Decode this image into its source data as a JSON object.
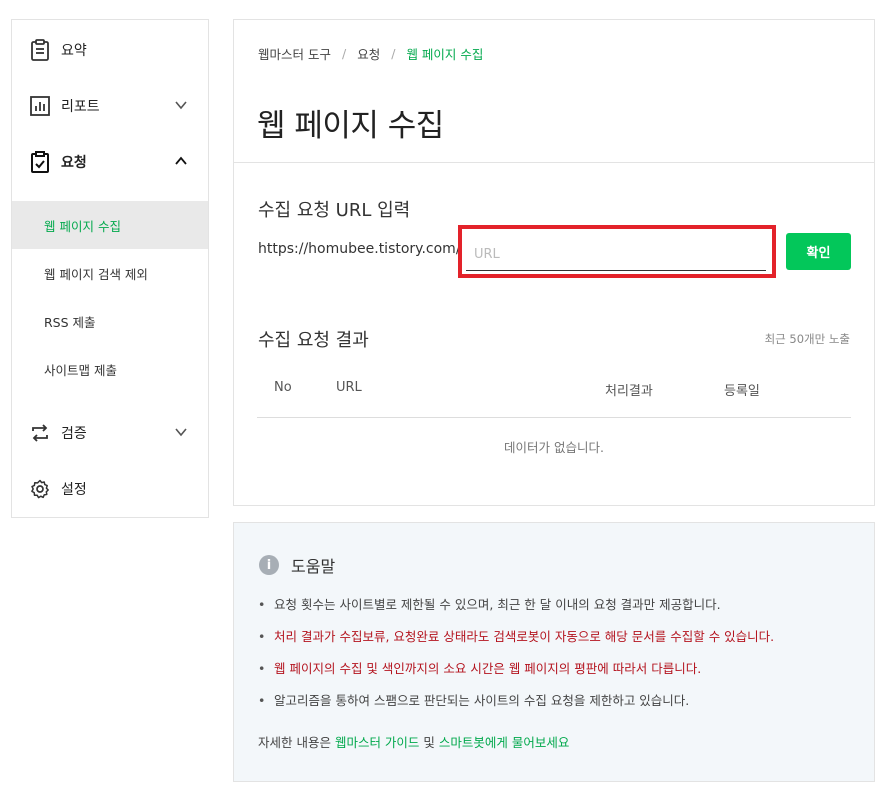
{
  "sidebar": {
    "items": [
      {
        "label": "요약",
        "icon": "clipboard-icon"
      },
      {
        "label": "리포트",
        "icon": "bar-chart-icon"
      },
      {
        "label": "요청",
        "icon": "clipboard-check-icon"
      },
      {
        "label": "검증",
        "icon": "repeat-icon"
      },
      {
        "label": "설정",
        "icon": "gear-icon"
      }
    ],
    "sub_items": [
      "웹 페이지 수집",
      "웹 페이지 검색 제외",
      "RSS 제출",
      "사이트맵 제출"
    ]
  },
  "breadcrumb": [
    "웹마스터 도구",
    "요청",
    "웹 페이지 수집"
  ],
  "page_title": "웹 페이지 수집",
  "request": {
    "title": "수집 요청 URL 입력",
    "url_prefix": "https://homubee.tistory.com/",
    "url_placeholder": "URL",
    "url_value": "",
    "confirm_label": "확인"
  },
  "results": {
    "title": "수집 요청 결과",
    "note": "최근 50개만 노출",
    "columns": [
      "No",
      "URL",
      "처리결과",
      "등록일"
    ],
    "rows": [],
    "empty_text": "데이터가 없습니다."
  },
  "help": {
    "title": "도움말",
    "items": [
      "요청 횟수는 사이트별로 제한될 수 있으며, 최근 한 달 이내의 요청 결과만 제공합니다.",
      "처리 결과가 수집보류, 요청완료 상태라도 검색로봇이 자동으로 해당 문서를 수집할 수 있습니다.",
      "웹 페이지의 수집 및 색인까지의 소요 시간은 웹 페이지의 평판에 따라서 다릅니다.",
      "알고리즘을 통하여 스팸으로 판단되는 사이트의 수집 요청을 제한하고 있습니다."
    ],
    "footer_prefix": "자세한 내용은 ",
    "link1": "웹마스터 가이드",
    "footer_mid": " 및 ",
    "link2": "스마트봇에게 물어보세요"
  },
  "colors": {
    "accent": "#03c75a",
    "accent_text": "#03a94d",
    "warning": "#b4141f",
    "highlight": "#e3222a"
  }
}
